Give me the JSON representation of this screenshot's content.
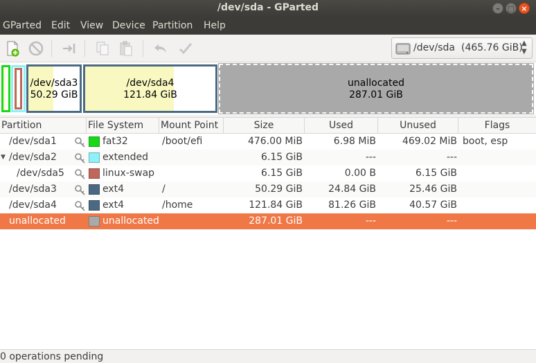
{
  "window": {
    "title": "/dev/sda - GParted"
  },
  "menu": [
    "GParted",
    "Edit",
    "View",
    "Device",
    "Partition",
    "Help"
  ],
  "toolbar": {
    "icons": [
      "new-partition-icon",
      "delete-icon",
      "resize-move-icon",
      "copy-icon",
      "paste-icon",
      "undo-icon",
      "apply-icon"
    ]
  },
  "device": {
    "name": "/dev/sda",
    "size": "(465.76 GiB)"
  },
  "map": {
    "sda3": {
      "name": "/dev/sda3",
      "size": "50.29 GiB"
    },
    "sda4": {
      "name": "/dev/sda4",
      "size": "121.84 GiB"
    },
    "unalloc": {
      "name": "unallocated",
      "size": "287.01 GiB"
    }
  },
  "columns": [
    "Partition",
    "File System",
    "Mount Point",
    "Size",
    "Used",
    "Unused",
    "Flags"
  ],
  "rows": [
    {
      "partition": "/dev/sda1",
      "fs": "fat32",
      "fs_color": "#18d818",
      "mount": "/boot/efi",
      "size": "476.00 MiB",
      "used": "6.98 MiB",
      "unused": "469.02 MiB",
      "flags": "boot, esp"
    },
    {
      "partition": "/dev/sda2",
      "fs": "extended",
      "fs_color": "#8ef0f8",
      "mount": "",
      "size": "6.15 GiB",
      "used": "---",
      "unused": "---",
      "flags": ""
    },
    {
      "partition": "/dev/sda5",
      "fs": "linux-swap",
      "fs_color": "#c1665a",
      "mount": "",
      "size": "6.15 GiB",
      "used": "0.00 B",
      "unused": "6.15 GiB",
      "flags": ""
    },
    {
      "partition": "/dev/sda3",
      "fs": "ext4",
      "fs_color": "#4b6983",
      "mount": "/",
      "size": "50.29 GiB",
      "used": "24.84 GiB",
      "unused": "25.46 GiB",
      "flags": ""
    },
    {
      "partition": "/dev/sda4",
      "fs": "ext4",
      "fs_color": "#4b6983",
      "mount": "/home",
      "size": "121.84 GiB",
      "used": "81.26 GiB",
      "unused": "40.57 GiB",
      "flags": ""
    },
    {
      "partition": "unallocated",
      "fs": "unallocated",
      "fs_color": "#a9a9a9",
      "mount": "",
      "size": "287.01 GiB",
      "used": "---",
      "unused": "---",
      "flags": ""
    }
  ],
  "status": "0 operations pending"
}
